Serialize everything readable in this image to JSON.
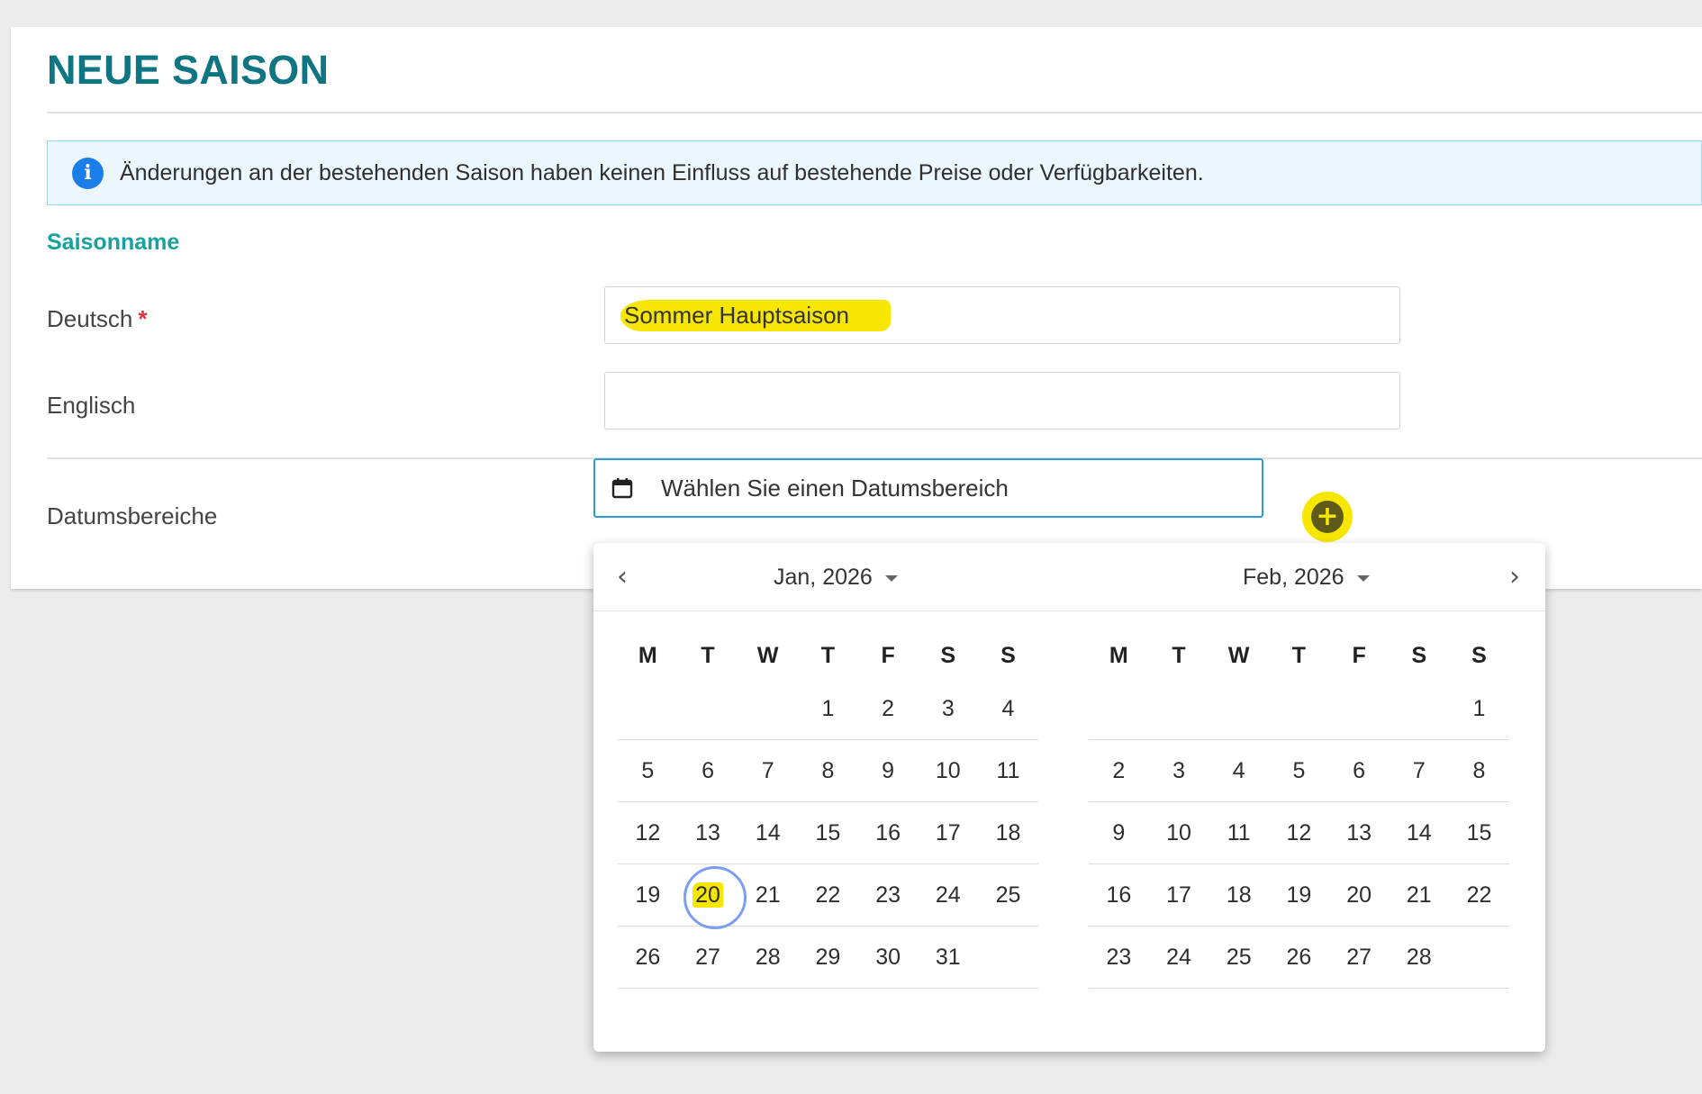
{
  "page": {
    "title": "NEUE SAISON"
  },
  "info": {
    "text": "Änderungen an der bestehenden Saison haben keinen Einfluss auf bestehende Preise oder Verfügbarkeiten.",
    "icon": "info-icon"
  },
  "section": {
    "label": "Saisonname"
  },
  "fields": {
    "deutsch": {
      "label": "Deutsch",
      "required_mark": "*",
      "value": "Sommer Hauptsaison"
    },
    "englisch": {
      "label": "Englisch",
      "value": ""
    },
    "dates": {
      "label": "Datumsbereiche",
      "placeholder": "Wählen Sie einen Datumsbereich"
    }
  },
  "add_button": {
    "label": "+"
  },
  "picker": {
    "prev": "‹",
    "next": "›",
    "left_month": "Jan, 2026",
    "right_month": "Feb, 2026",
    "weekdays": [
      "M",
      "T",
      "W",
      "T",
      "F",
      "S",
      "S"
    ],
    "selected_day": "20",
    "jan_weeks": [
      [
        "",
        "",
        "",
        "1",
        "2",
        "3",
        "4"
      ],
      [
        "5",
        "6",
        "7",
        "8",
        "9",
        "10",
        "11"
      ],
      [
        "12",
        "13",
        "14",
        "15",
        "16",
        "17",
        "18"
      ],
      [
        "19",
        "20",
        "21",
        "22",
        "23",
        "24",
        "25"
      ],
      [
        "26",
        "27",
        "28",
        "29",
        "30",
        "31",
        ""
      ]
    ],
    "feb_weeks": [
      [
        "",
        "",
        "",
        "",
        "",
        "",
        "1"
      ],
      [
        "2",
        "3",
        "4",
        "5",
        "6",
        "7",
        "8"
      ],
      [
        "9",
        "10",
        "11",
        "12",
        "13",
        "14",
        "15"
      ],
      [
        "16",
        "17",
        "18",
        "19",
        "20",
        "21",
        "22"
      ],
      [
        "23",
        "24",
        "25",
        "26",
        "27",
        "28",
        ""
      ]
    ]
  },
  "colors": {
    "title": "#0f7582",
    "section": "#17a2a0",
    "highlight": "#f7e700",
    "focus": "#2d9cdb",
    "info_bg": "#ecf7fd"
  }
}
